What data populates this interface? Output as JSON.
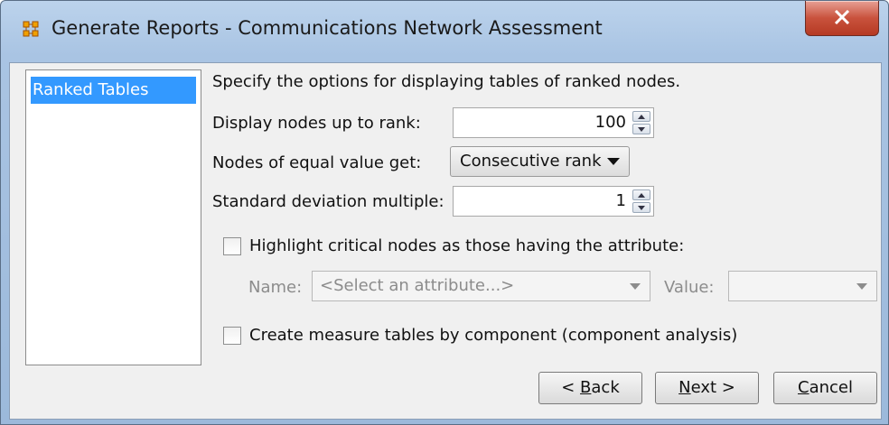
{
  "window": {
    "title": "Generate Reports - Communications Network Assessment",
    "close_label": "X"
  },
  "sidebar": {
    "items": [
      {
        "label": "Ranked Tables",
        "selected": true
      }
    ]
  },
  "main": {
    "description": "Specify the options for displaying tables of ranked nodes.",
    "rank": {
      "label": "Display nodes up to rank:",
      "value": "100"
    },
    "equal": {
      "label": "Nodes of equal value get:",
      "selected": "Consecutive rank"
    },
    "stddev": {
      "label": "Standard deviation multiple:",
      "value": "1"
    },
    "highlight": {
      "label": "Highlight critical nodes as those having the attribute:",
      "checked": false,
      "name_label": "Name:",
      "name_placeholder": "<Select an attribute...>",
      "value_label": "Value:",
      "value_value": ""
    },
    "component": {
      "label": "Create measure tables by component (component analysis)",
      "checked": false
    }
  },
  "buttons": {
    "back": {
      "prefix": "< ",
      "mnemonic": "B",
      "rest": "ack"
    },
    "next": {
      "mnemonic": "N",
      "rest": "ext >"
    },
    "cancel": {
      "mnemonic": "C",
      "rest": "ancel"
    }
  },
  "colors": {
    "selection": "#3399ff",
    "close_button": "#c9523d",
    "frame": "#a9c4e3"
  }
}
